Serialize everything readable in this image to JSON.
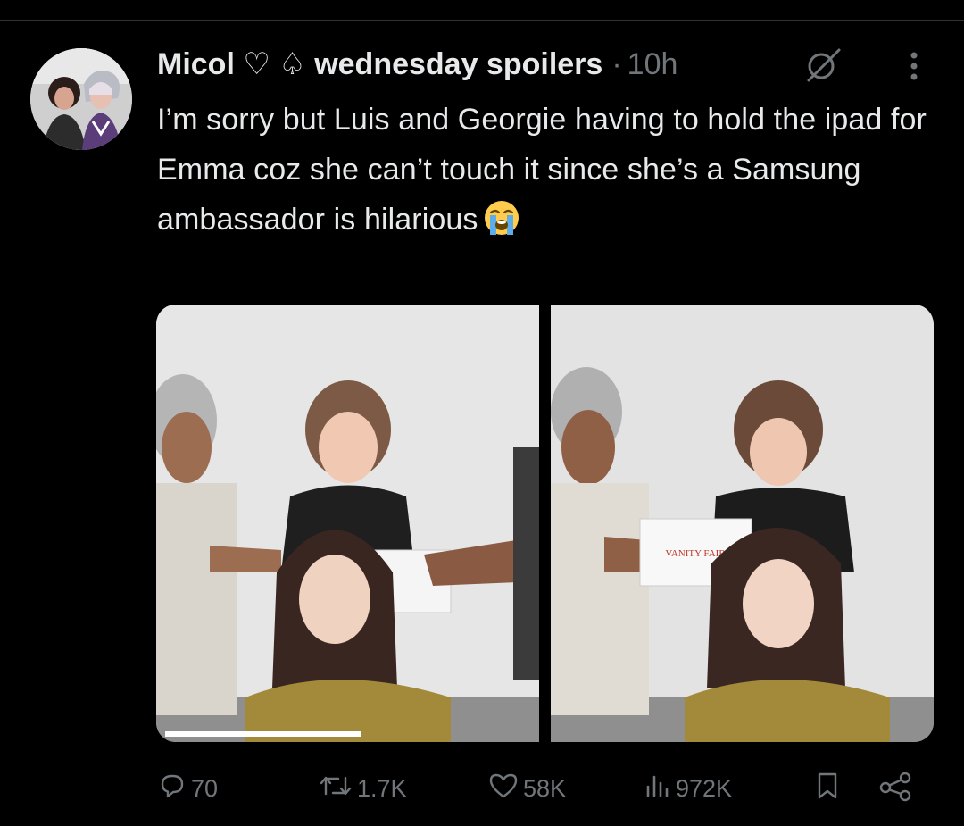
{
  "tweet": {
    "author": {
      "display_name": "Micol ♡ ♤ wednesday spoilers",
      "avatar": "profile-photo"
    },
    "separator": "·",
    "time": "10h",
    "text": "I’m sorry but Luis and Georgie having to hold the ipad for Emma coz she can’t touch it since she’s a Samsung ambassador is hilarious",
    "emoji": "loudly-crying-face",
    "media": [
      {
        "kind": "photo",
        "subject": "press-junket-photo-1"
      },
      {
        "kind": "photo",
        "subject": "press-junket-photo-2",
        "sign_text": "VANITY FAIR"
      }
    ],
    "stats": {
      "replies": "70",
      "reposts": "1.7K",
      "likes": "58K",
      "views": "972K"
    }
  },
  "icons": {
    "grok": "grok-icon",
    "more": "more-icon",
    "reply": "reply-icon",
    "repost": "repost-icon",
    "like": "like-icon",
    "views": "views-icon",
    "bookmark": "bookmark-icon",
    "share": "share-icon"
  },
  "colors": {
    "background": "#000000",
    "text_primary": "#e7e9ea",
    "text_secondary": "#71767b",
    "divider": "#2f3336"
  }
}
